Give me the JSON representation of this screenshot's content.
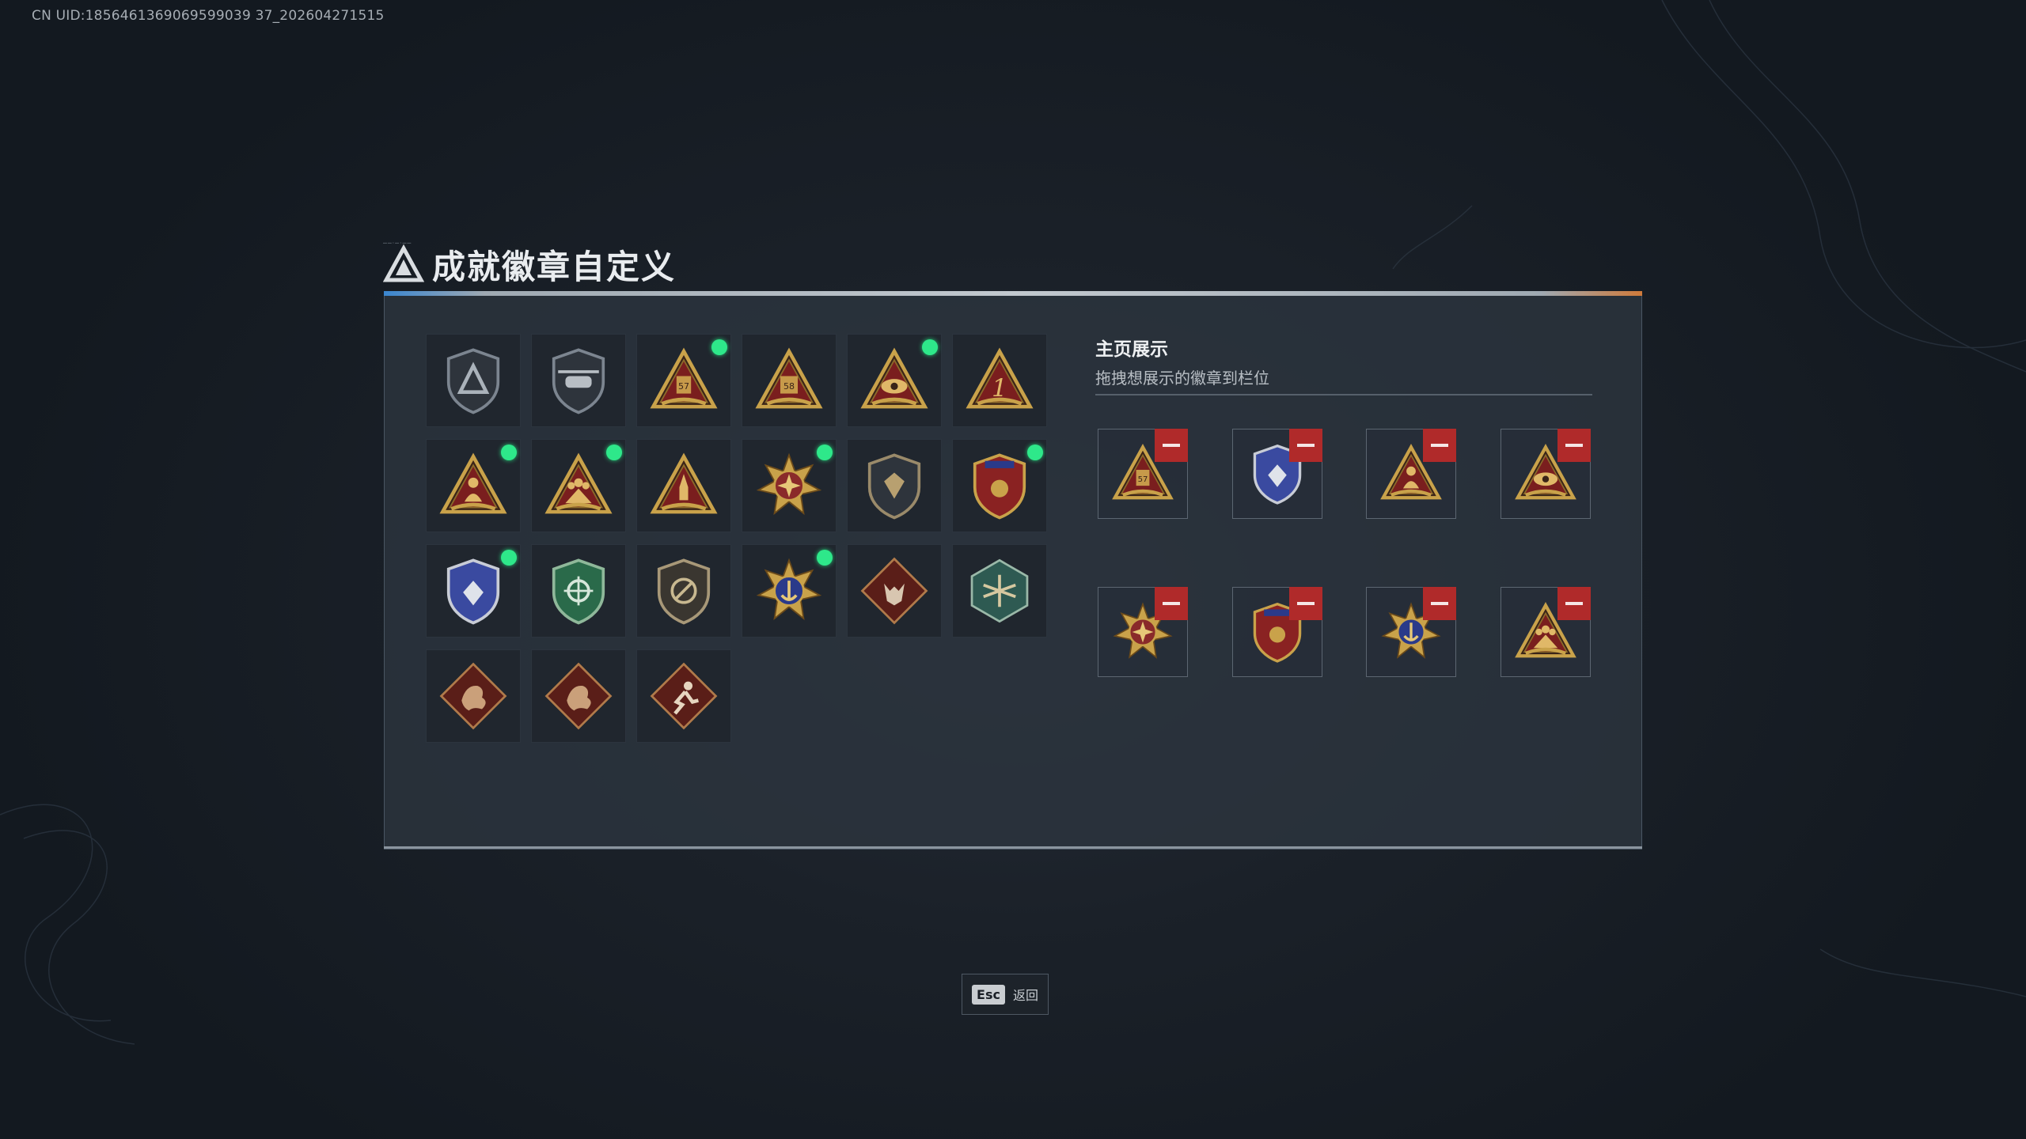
{
  "uid": "CN UID:1856461369069599039 37_202604271515",
  "header": {
    "title": "成就徽章自定义"
  },
  "badge_grid": [
    {
      "icon": "shield-delta-badge-icon",
      "new": false
    },
    {
      "icon": "helicopter-shield-badge-icon",
      "new": false
    },
    {
      "icon": "triangle-57-badge-icon",
      "new": true
    },
    {
      "icon": "triangle-58-badge-icon",
      "new": false
    },
    {
      "icon": "triangle-eye-badge-icon",
      "new": true
    },
    {
      "icon": "triangle-number-one-badge-icon",
      "new": false
    },
    {
      "icon": "triangle-soldier-badge-icon",
      "new": true
    },
    {
      "icon": "triangle-squad-badge-icon",
      "new": true
    },
    {
      "icon": "triangle-rocket-badge-icon",
      "new": false
    },
    {
      "icon": "star-compass-medal-icon",
      "new": true
    },
    {
      "icon": "shield-emblem-badge-icon",
      "new": false
    },
    {
      "icon": "red-stars-shield-medal-icon",
      "new": true
    },
    {
      "icon": "blue-diamond-shield-medal-icon",
      "new": true
    },
    {
      "icon": "green-crosshair-shield-badge-icon",
      "new": false
    },
    {
      "icon": "no-rifle-shield-badge-icon",
      "new": false
    },
    {
      "icon": "gold-anchor-crest-medal-icon",
      "new": true
    },
    {
      "icon": "wolf-diamond-badge-icon",
      "new": false
    },
    {
      "icon": "dragonfly-hexagon-badge-icon",
      "new": false
    },
    {
      "icon": "dragon-diamond-badge-icon",
      "new": false
    },
    {
      "icon": "dragon-diamond-badge-2-icon",
      "new": false
    },
    {
      "icon": "runner-diamond-badge-icon",
      "new": false
    }
  ],
  "display": {
    "title": "主页展示",
    "subtitle": "拖拽想展示的徽章到栏位",
    "slots": [
      {
        "icon": "triangle-57-badge-icon"
      },
      {
        "icon": "blue-diamond-shield-medal-icon"
      },
      {
        "icon": "triangle-soldier-badge-icon"
      },
      {
        "icon": "triangle-eye-badge-icon"
      },
      {
        "icon": "star-compass-medal-icon"
      },
      {
        "icon": "red-stars-shield-medal-icon"
      },
      {
        "icon": "gold-anchor-crest-medal-icon"
      },
      {
        "icon": "triangle-squad-badge-icon"
      }
    ]
  },
  "footer": {
    "key": "Esc",
    "label": "返回"
  },
  "colors": {
    "new_dot": "#2ee88a",
    "remove": "#b02a2a",
    "gold": "#c9a24a",
    "red_fill": "#7a1e1e"
  }
}
